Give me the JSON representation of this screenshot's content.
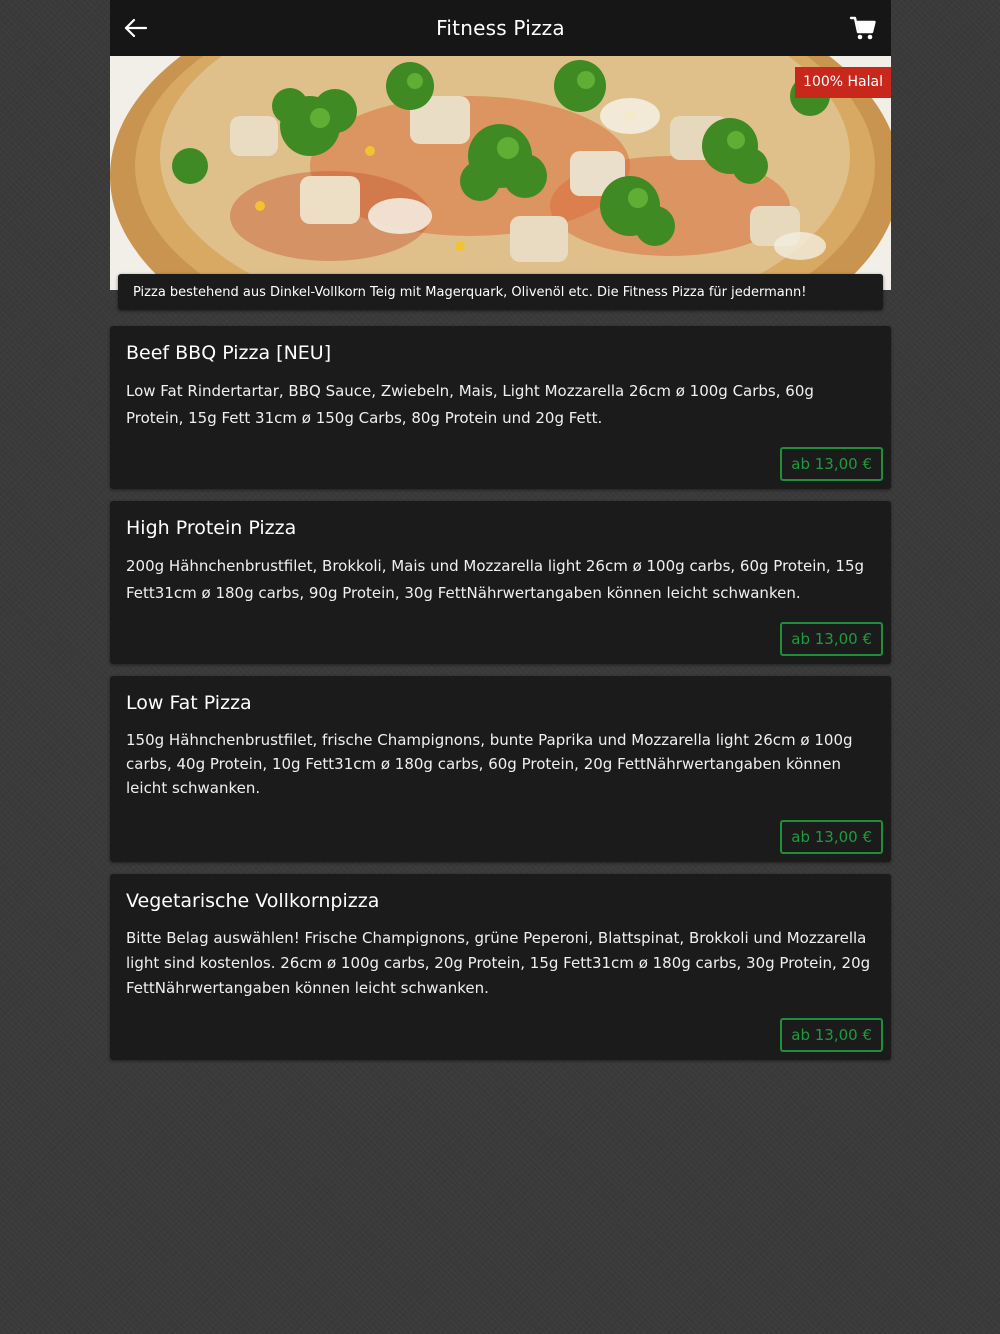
{
  "header": {
    "title": "Fitness Pizza",
    "back_icon": "arrow-left-icon",
    "cart_icon": "cart-icon"
  },
  "hero": {
    "badge": "100% Halal",
    "caption": "Pizza bestehend aus Dinkel-Vollkorn Teig mit Magerquark, Olivenöl etc. Die Fitness Pizza für jedermann!"
  },
  "products": [
    {
      "name": "Beef BBQ Pizza [NEU]",
      "description": "Low Fat Rindertartar, BBQ Sauce, Zwiebeln, Mais, Light Mozzarella 26cm ø 100g Carbs, 60g Protein, 15g Fett 31cm ø 150g Carbs, 80g Protein und 20g Fett.",
      "price": "ab 13,00 €"
    },
    {
      "name": "High Protein Pizza",
      "description": "200g Hähnchenbrustfilet, Brokkoli, Mais und Mozzarella light 26cm ø 100g carbs, 60g Protein, 15g Fett31cm ø 180g carbs, 90g Protein, 30g FettNährwertangaben können leicht schwanken.",
      "price": "ab 13,00 €"
    },
    {
      "name": "Low Fat Pizza",
      "description": "150g Hähnchenbrustfilet, frische Champignons, bunte Paprika und Mozzarella light 26cm ø 100g carbs, 40g Protein, 10g Fett31cm ø 180g carbs, 60g Protein, 20g FettNährwertangaben können leicht schwanken.",
      "price": "ab 13,00 €"
    },
    {
      "name": "Vegetarische Vollkornpizza",
      "description": "Bitte Belag auswählen! Frische Champignons, grüne Peperoni, Blattspinat, Brokkoli und Mozzarella light sind kostenlos. 26cm ø 100g carbs, 20g Protein, 15g Fett31cm ø 180g carbs, 30g Protein, 20g FettNährwertangaben können leicht schwanken.",
      "price": "ab 13,00 €"
    }
  ],
  "colors": {
    "badge": "#c8271c",
    "price_accent": "#1f8f3a",
    "card_bg": "#1b1b1b",
    "header_bg": "#161616"
  }
}
